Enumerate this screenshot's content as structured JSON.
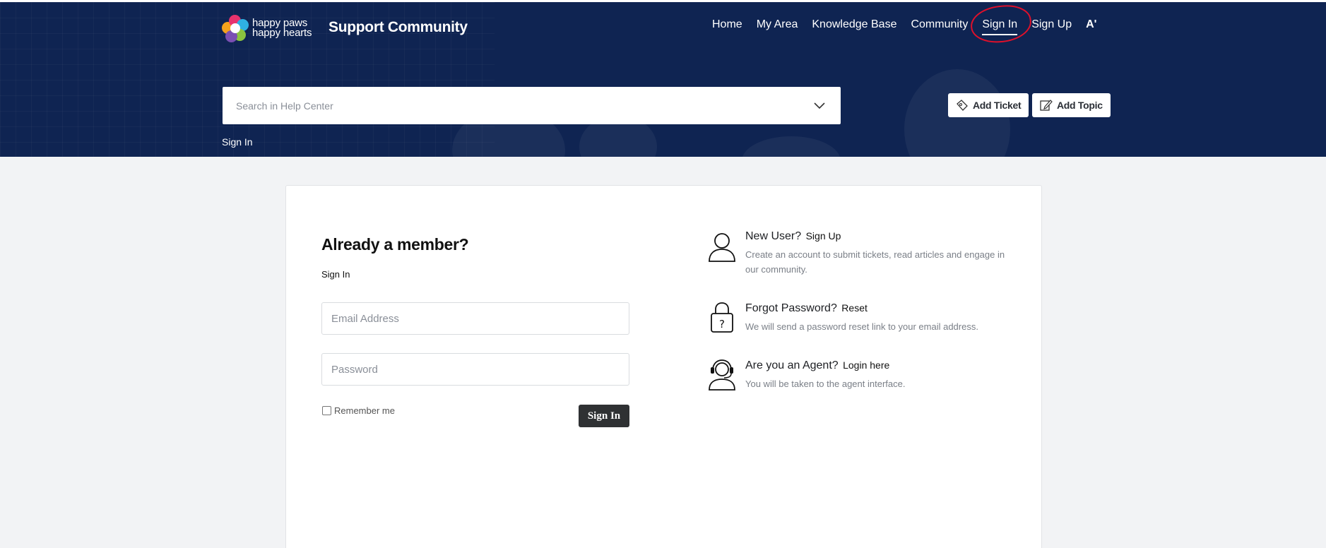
{
  "header": {
    "logo_line1": "happy paws",
    "logo_line2": "happy hearts",
    "site_title": "Support Community",
    "nav": [
      "Home",
      "My Area",
      "Knowledge Base",
      "Community",
      "Sign In",
      "Sign Up"
    ],
    "font_size_icon": "A'",
    "search_placeholder": "Search in Help Center",
    "add_ticket": "Add Ticket",
    "add_topic": "Add Topic",
    "breadcrumb": "Sign In"
  },
  "login": {
    "heading": "Already a member?",
    "subheading": "Sign In",
    "email_placeholder": "Email Address",
    "password_placeholder": "Password",
    "remember_label": "Remember me",
    "submit_label": "Sign In"
  },
  "side": {
    "new_user_title": "New User?",
    "new_user_link": "Sign Up",
    "new_user_desc": "Create an account to submit tickets, read articles and engage in our community.",
    "forgot_title": "Forgot Password?",
    "forgot_link": "Reset",
    "forgot_desc": "We will send a password reset link to your email address.",
    "agent_title": "Are you an Agent?",
    "agent_link": "Login here",
    "agent_desc": "You will be taken to the agent interface."
  },
  "colors": {
    "header_bg": "#0f2452",
    "annotation_circle": "#e0102a",
    "button_dark": "#2f3133"
  }
}
